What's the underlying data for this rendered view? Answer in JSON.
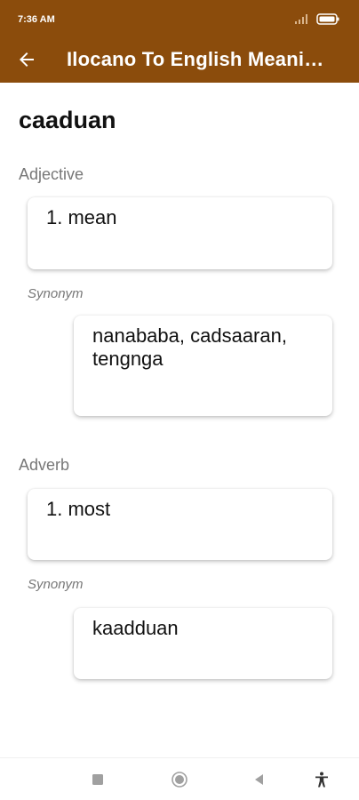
{
  "status_bar": {
    "time": "7:36 AM",
    "battery_icon": "battery-icon",
    "signal_icon": "signal-icon"
  },
  "toolbar": {
    "back_icon": "back-arrow-icon",
    "title": "Ilocano To English Meani…"
  },
  "word": "caaduan",
  "entries": [
    {
      "part_of_speech": "Adjective",
      "meaning": "1. mean",
      "synonym_label": "Synonym",
      "synonyms": "nanababa, cadsaaran, tengnga"
    },
    {
      "part_of_speech": "Adverb",
      "meaning": "1. most",
      "synonym_label": "Synonym",
      "synonyms": "kaadduan"
    }
  ],
  "nav_bar": {
    "icons": [
      "recents-square-icon",
      "home-circle-icon",
      "back-triangle-icon",
      "accessibility-icon"
    ]
  },
  "colors": {
    "app_bar": "#8b4c0c",
    "title_text": "#ffffff",
    "label_grey": "#777777"
  }
}
